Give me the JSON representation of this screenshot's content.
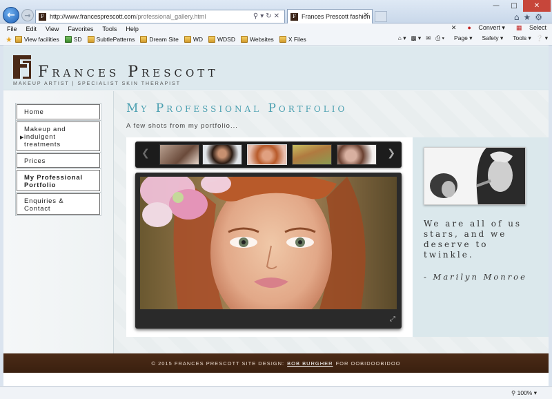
{
  "browser": {
    "url_prefix": "http://www.francesprescott.com",
    "url_path": "/professional_gallery.html",
    "tab_title": "Frances Prescott fashion sh...",
    "menu": [
      "File",
      "Edit",
      "View",
      "Favorites",
      "Tools",
      "Help"
    ],
    "menu_right": {
      "convert": "Convert",
      "select": "Select"
    },
    "favorites": [
      "View facilities",
      "SD",
      "SubtlePatterns",
      "Dream Site",
      "WD",
      "WDSD",
      "Websites",
      "X Files"
    ],
    "command_bar": {
      "page": "Page",
      "safety": "Safety",
      "tools": "Tools"
    },
    "zoom_level": "100%"
  },
  "site": {
    "title": "Frances Prescott",
    "tagline": "MAKEUP ARTIST | SPECIALIST SKIN THERAPIST",
    "nav": [
      {
        "label": "Home",
        "active": false
      },
      {
        "label": "Makeup and indulgent treatments",
        "active": false
      },
      {
        "label": "Prices",
        "active": false
      },
      {
        "label": "My Professional Portfolio",
        "active": true
      },
      {
        "label": "Enquiries & Contact",
        "active": false
      }
    ],
    "portfolio_title": "My Professional Portfolio",
    "portfolio_subtitle": "A few shots from my portfolio...",
    "quote": "We are all of us stars, and we deserve to twinkle.",
    "quote_author": "- Marilyn Monroe",
    "footer_prefix": "© 2015 FRANCES PRESCOTT SITE DESIGN:",
    "footer_link": "BOB BURGHER",
    "footer_suffix": "FOR OOBIDOOBIDOO"
  },
  "colors": {
    "brand_brown": "#4a2a18",
    "accent_teal": "#4a9fb0",
    "header_bg": "#dde9ee"
  }
}
